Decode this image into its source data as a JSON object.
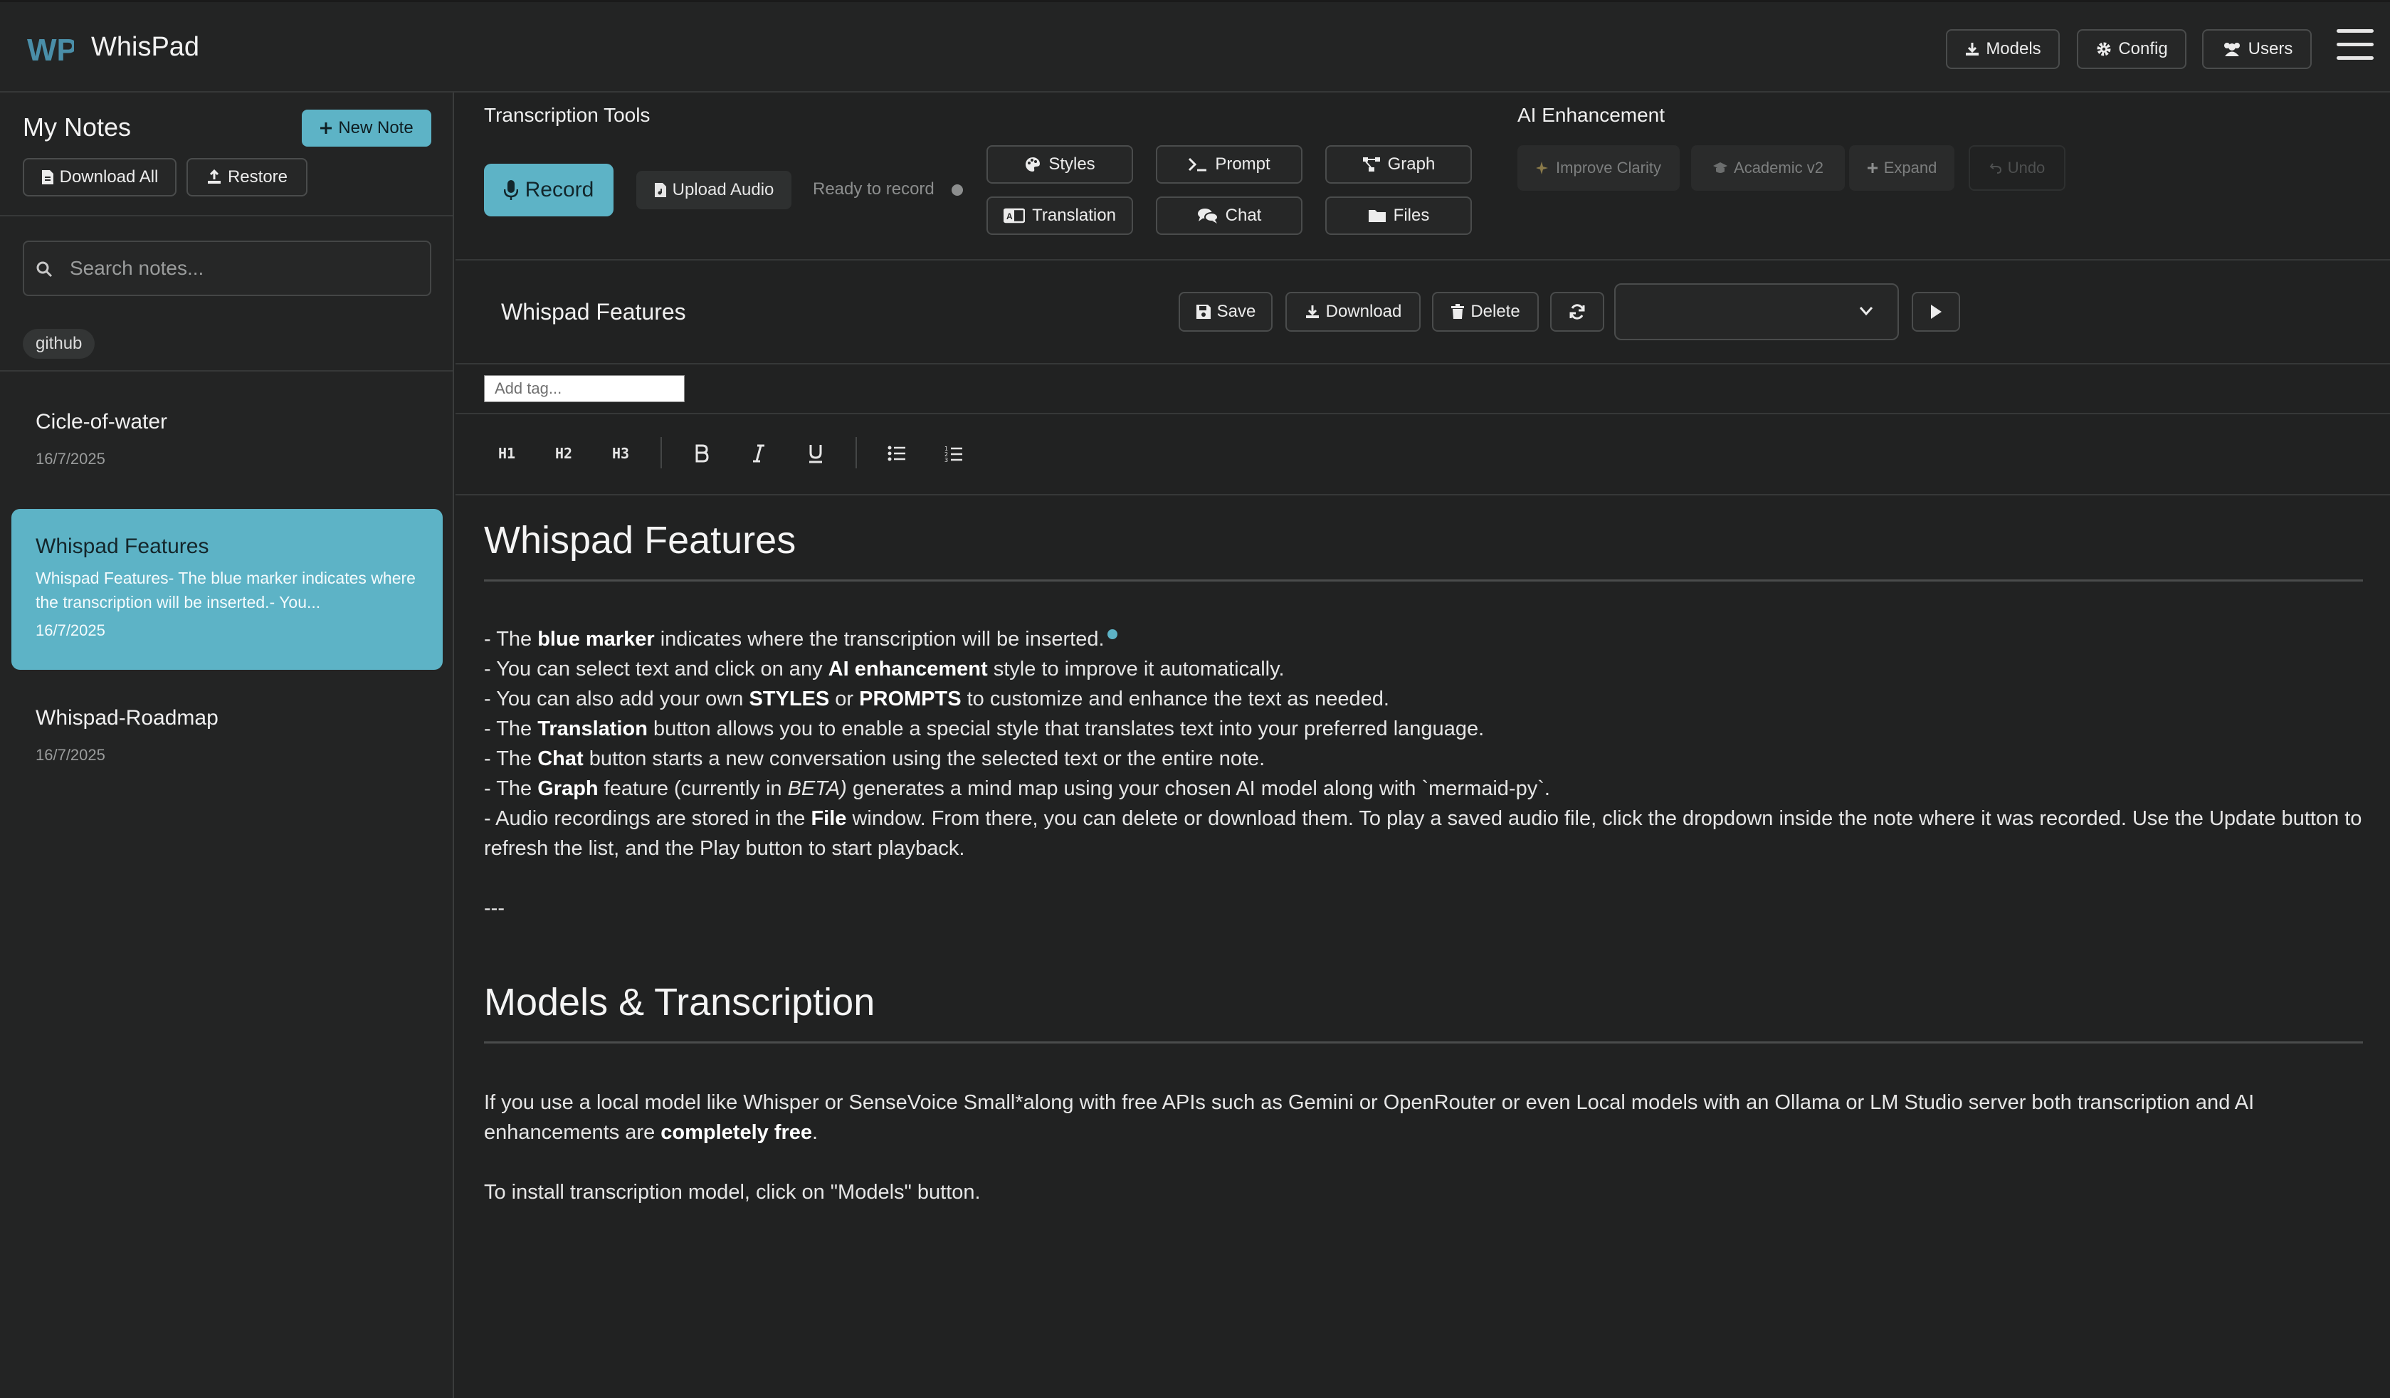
{
  "app": {
    "title": "WhisPad",
    "logo_text": "WP"
  },
  "header": {
    "models_label": "Models",
    "config_label": "Config",
    "users_label": "Users"
  },
  "sidebar": {
    "title": "My Notes",
    "new_note_label": "New Note",
    "download_all_label": "Download All",
    "restore_label": "Restore",
    "search_placeholder": "Search notes...",
    "tags": [
      "github"
    ],
    "notes": [
      {
        "title": "Cicle-of-water",
        "date": "16/7/2025",
        "active": false
      },
      {
        "title": "Whispad Features",
        "preview": "Whispad Features- The blue marker indicates where the transcription will be inserted.- You...",
        "date": "16/7/2025",
        "active": true
      },
      {
        "title": "Whispad-Roadmap",
        "date": "16/7/2025",
        "active": false
      }
    ]
  },
  "tools": {
    "transcription_title": "Transcription Tools",
    "record_label": "Record",
    "upload_label": "Upload Audio",
    "status_text": "Ready to record",
    "buttons": {
      "styles": "Styles",
      "prompt": "Prompt",
      "graph": "Graph",
      "translation": "Translation",
      "chat": "Chat",
      "files": "Files"
    },
    "ai_title": "AI Enhancement",
    "ai_buttons": {
      "improve": "Improve Clarity",
      "academic": "Academic v2",
      "expand": "Expand",
      "undo": "Undo"
    }
  },
  "note": {
    "title": "Whispad Features",
    "save_label": "Save",
    "download_label": "Download",
    "delete_label": "Delete",
    "tag_placeholder": "Add tag..."
  },
  "format_toolbar": {
    "h1": "H1",
    "h2": "H2",
    "h3": "H3"
  },
  "content": {
    "heading1": "Whispad Features",
    "heading2": "Models & Transcription",
    "lines": [
      [
        {
          "t": "- The "
        },
        {
          "t": "blue marker",
          "b": true
        },
        {
          "t": " indicates where the transcription will be inserted."
        }
      ],
      [
        {
          "t": "- You can select text and click on any "
        },
        {
          "t": "AI enhancement",
          "b": true
        },
        {
          "t": " style to improve it automatically."
        }
      ],
      [
        {
          "t": "- You can also add your own "
        },
        {
          "t": "STYLES",
          "b": true
        },
        {
          "t": " or "
        },
        {
          "t": "PROMPTS",
          "b": true
        },
        {
          "t": " to customize and enhance the text as needed."
        }
      ],
      [
        {
          "t": "- The "
        },
        {
          "t": "Translation",
          "b": true
        },
        {
          "t": " button allows you to enable a special style that translates text into your preferred language."
        }
      ],
      [
        {
          "t": "- The "
        },
        {
          "t": "Chat",
          "b": true
        },
        {
          "t": " button starts a new conversation using the selected text or the entire note."
        }
      ],
      [
        {
          "t": "- The "
        },
        {
          "t": "Graph",
          "b": true
        },
        {
          "t": " feature (currently in "
        },
        {
          "t": "BETA)",
          "i": true
        },
        {
          "t": " generates a mind map using your chosen AI model along with `mermaid-py`."
        }
      ],
      [
        {
          "t": "- Audio recordings are stored in the "
        },
        {
          "t": "File",
          "b": true
        },
        {
          "t": " window. From there, you can delete or download them. To play a saved audio file, click the dropdown inside the note where it was recorded. Use the Update button to refresh the list, and the Play button to start playback."
        }
      ]
    ],
    "separator": "---",
    "models_para": [
      {
        "t": "If you use a local model like Whisper or SenseVoice Small*along with free APIs such as Gemini or OpenRouter or even Local models with an Ollama or LM Studio server both transcription and AI enhancements are "
      },
      {
        "t": "completely free",
        "b": true
      },
      {
        "t": "."
      }
    ],
    "install_text": "To install transcription model, click on \"Models\" button."
  },
  "colors": {
    "accent": "#5db3c6",
    "background": "#212222",
    "panel": "#232424",
    "border": "#4a4c4c"
  }
}
